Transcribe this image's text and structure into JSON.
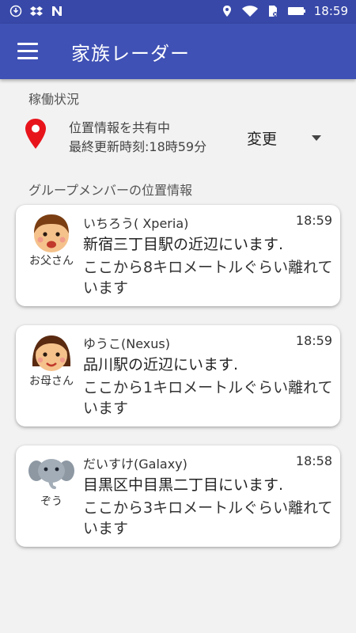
{
  "status_bar": {
    "time": "18:59",
    "icons": [
      "sync-icon",
      "dropbox-icon",
      "n-icon",
      "location-icon",
      "wifi-icon",
      "sim-icon",
      "battery-icon"
    ]
  },
  "app_bar": {
    "title": "家族レーダー",
    "menu_icon": "hamburger-menu-icon"
  },
  "operation": {
    "section_title": "稼働状況",
    "status_line1": "位置情報を共有中",
    "status_line2": "最終更新時刻:18時59分",
    "change_label": "変更",
    "pin_color": "#e8141c"
  },
  "members_section_title": "グループメンバーの位置情報",
  "members": [
    {
      "avatar_label": "お父さん",
      "name": "いちろう( Xperia)",
      "time": "18:59",
      "location": "新宿三丁目駅の近辺にいます.",
      "distance": "ここから8キロメートルぐらい離れています"
    },
    {
      "avatar_label": "お母さん",
      "name": "ゆうこ(Nexus)",
      "time": "18:59",
      "location": "品川駅の近辺にいます.",
      "distance": "ここから1キロメートルぐらい離れています"
    },
    {
      "avatar_label": "ぞう",
      "name": "だいすけ(Galaxy)",
      "time": "18:58",
      "location": "目黒区中目黒二丁目にいます.",
      "distance": "ここから3キロメートルぐらい離れています"
    }
  ],
  "colors": {
    "app_bar": "#3f51b5",
    "status_bar": "#3848a8",
    "background": "#f2f2f2"
  }
}
